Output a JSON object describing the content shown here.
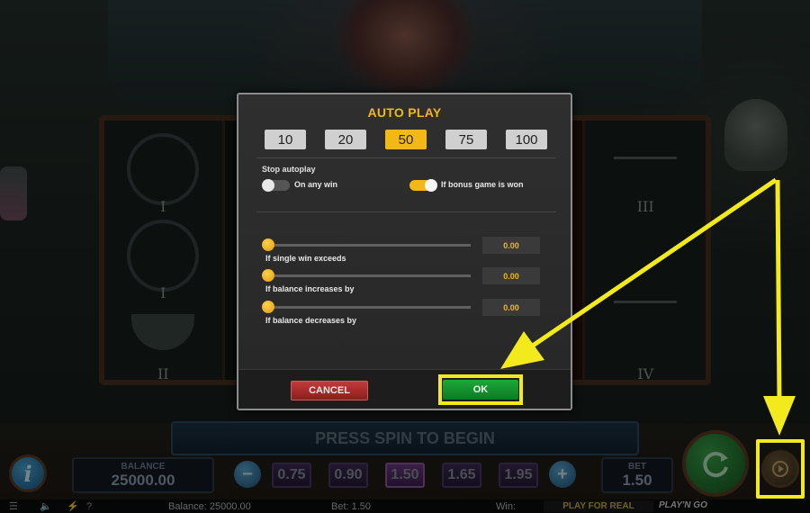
{
  "game": {
    "press_spin_text": "PRESS SPIN TO BEGIN",
    "balance_label": "BALANCE",
    "balance_value": "25000.00",
    "bet_label": "BET",
    "bet_value": "1.50",
    "bet_options": [
      {
        "label": "0.75",
        "selected": false
      },
      {
        "label": "0.90",
        "selected": false
      },
      {
        "label": "1.50",
        "selected": true
      },
      {
        "label": "1.65",
        "selected": false
      },
      {
        "label": "1.95",
        "selected": false
      }
    ],
    "bet_minus": "−",
    "bet_plus": "+",
    "info_label": "i",
    "reel_numerals": [
      "I",
      "I",
      "II",
      "III",
      "IV",
      "IV"
    ]
  },
  "status_bar": {
    "balance": "Balance: 25000.00",
    "bet": "Bet: 1.50",
    "win": "Win:",
    "play_for_real": "PLAY FOR REAL",
    "logo": "PLAY'N GO",
    "icons": [
      "menu-icon",
      "sound-icon",
      "turbo-icon",
      "help-icon"
    ],
    "help_glyph": "?"
  },
  "dialog": {
    "title": "AUTO PLAY",
    "spin_options": [
      {
        "label": "10",
        "selected": false
      },
      {
        "label": "20",
        "selected": false
      },
      {
        "label": "50",
        "selected": true
      },
      {
        "label": "75",
        "selected": false
      },
      {
        "label": "100",
        "selected": false
      }
    ],
    "stop_autoplay_label": "Stop autoplay",
    "toggles": [
      {
        "label": "On any win",
        "on": false
      },
      {
        "label": "If bonus game is won",
        "on": true
      }
    ],
    "sliders": [
      {
        "label": "If single win exceeds",
        "value": "0.00"
      },
      {
        "label": "If balance increases by",
        "value": "0.00"
      },
      {
        "label": "If balance decreases by",
        "value": "0.00"
      }
    ],
    "cancel_label": "CANCEL",
    "ok_label": "OK"
  },
  "colors": {
    "accent": "#f2b818",
    "annotation": "#f2ea1c",
    "ok_green": "#1ea83a",
    "cancel_red": "#c23a3a"
  }
}
